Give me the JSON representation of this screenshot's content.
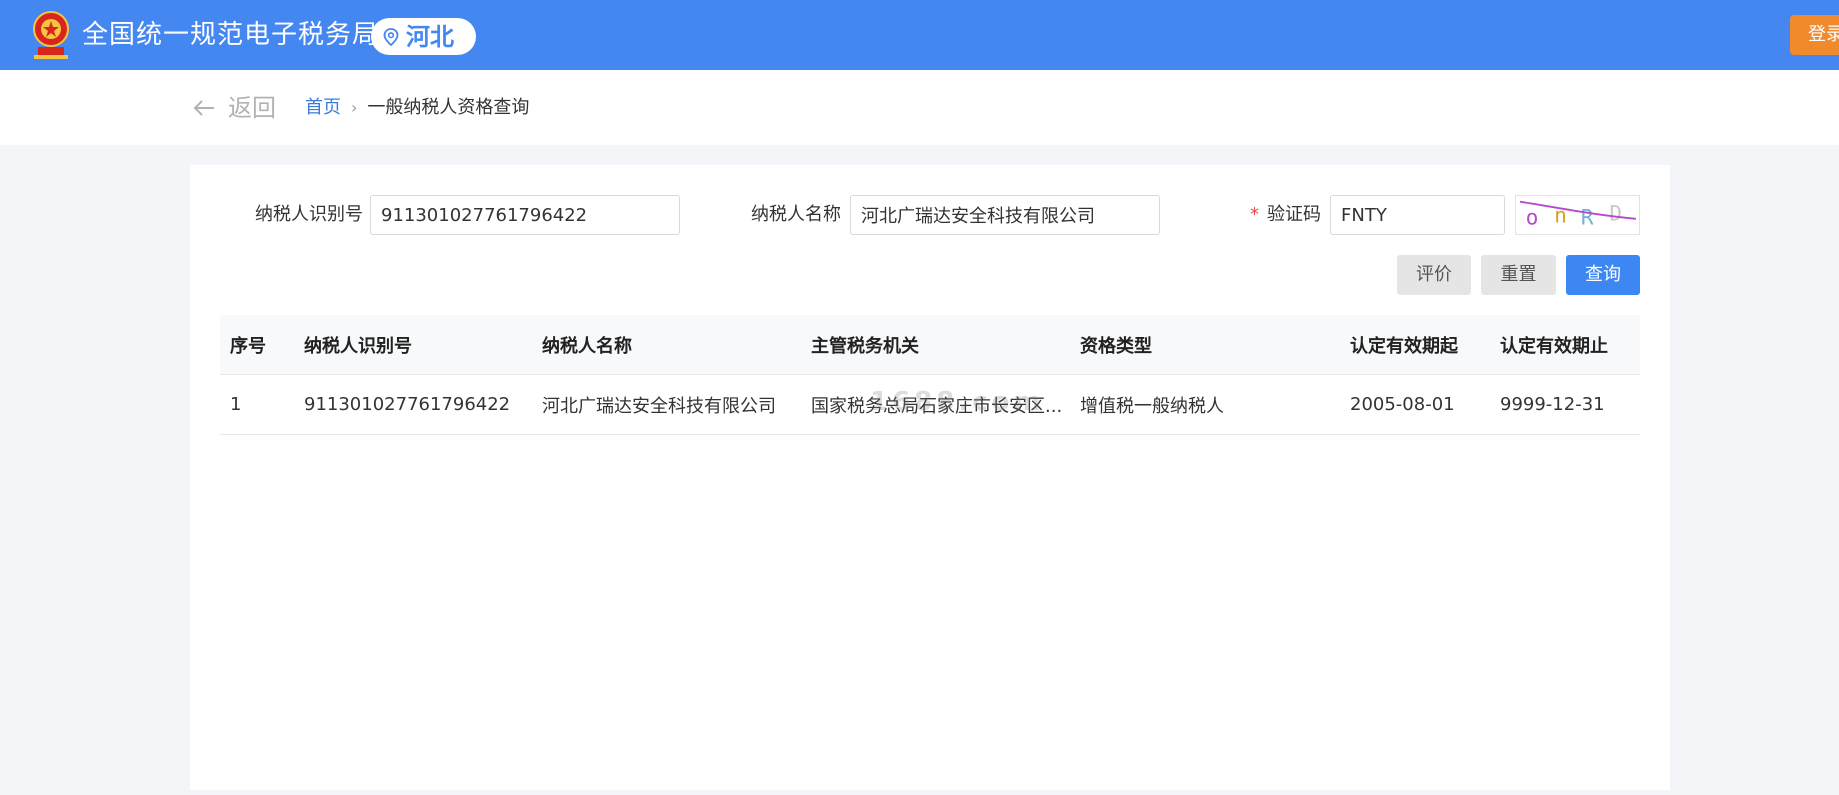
{
  "header": {
    "site_title": "全国统一规范电子税务局",
    "region": "河北",
    "login_label": "登录",
    "brand_color": "#4487f1"
  },
  "nav": {
    "back_label": "返回",
    "breadcrumb_home": "首页",
    "breadcrumb_sep": "›",
    "breadcrumb_current": "一般纳税人资格查询"
  },
  "form": {
    "taxpayer_id_label": "纳税人识别号",
    "taxpayer_id_value": "911301027761796422",
    "taxpayer_name_label": "纳税人名称",
    "taxpayer_name_value": "河北广瑞达安全科技有限公司",
    "captcha_required_mark": "*",
    "captcha_label": "验证码",
    "captcha_value": "FNTY",
    "captcha_image_text": "oNRD"
  },
  "buttons": {
    "evaluate": "评价",
    "reset": "重置",
    "search": "查询"
  },
  "table": {
    "headers": [
      "序号",
      "纳税人识别号",
      "纳税人名称",
      "主管税务机关",
      "资格类型",
      "认定有效期起",
      "认定有效期止"
    ],
    "rows": [
      [
        "1",
        "911301027761796422",
        "河北广瑞达安全科技有限公司",
        "国家税务总局石家庄市长安区...",
        "增值税一般纳税人",
        "2005-08-01",
        "9999-12-31"
      ]
    ],
    "watermark": "1688.com"
  }
}
